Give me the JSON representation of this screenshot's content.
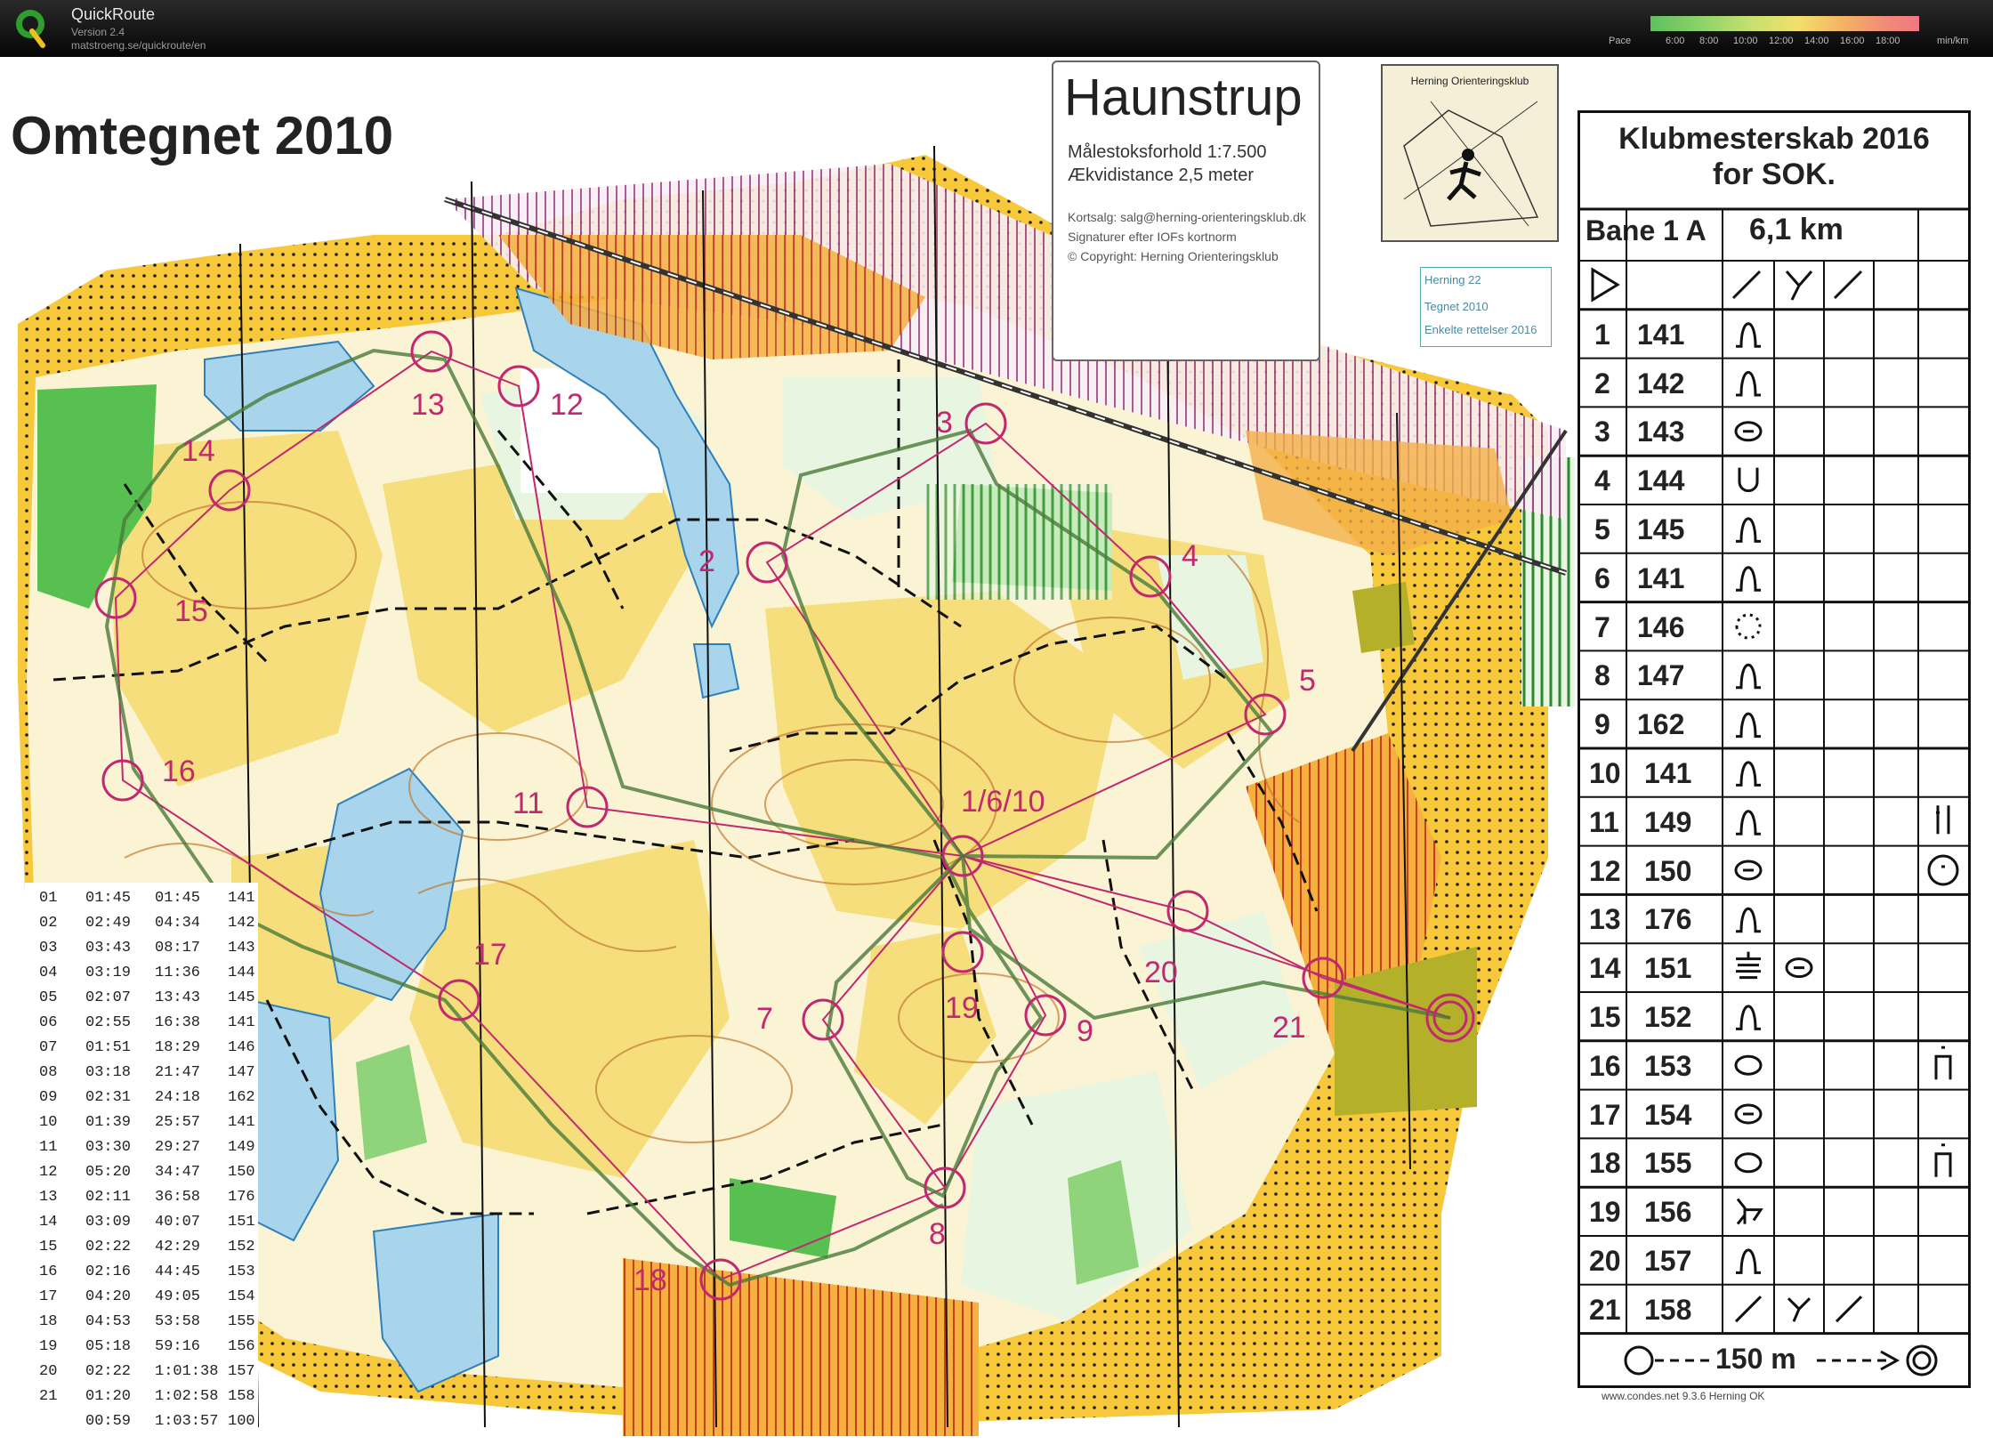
{
  "app": {
    "name": "QuickRoute",
    "version": "Version 2.4",
    "url": "matstroeng.se/quickroute/en",
    "pace_label": "Pace",
    "pace_ticks": [
      "6:00",
      "8:00",
      "10:00",
      "12:00",
      "14:00",
      "16:00",
      "18:00"
    ],
    "pace_unit": "min/km"
  },
  "map": {
    "title": "Omtegnet 2010",
    "name": "Haunstrup",
    "scale": "Målestoksforhold 1:7.500",
    "contour": "Ækvidistance 2,5 meter",
    "sales": "Kortsalg: salg@herning-orienteringsklub.dk",
    "symbols": "Signaturer efter IOFs kortnorm",
    "copyright": "© Copyright: Herning Orienteringsklub",
    "club_logo": "Herning Orienteringsklub",
    "edit_notes": [
      "Herning 22",
      "Tegnet 2010",
      "Enkelte rettelser 2016"
    ],
    "control_labels": [
      "1/6/10",
      "2",
      "3",
      "4",
      "5",
      "7",
      "8",
      "9",
      "11",
      "12",
      "13",
      "14",
      "15",
      "16",
      "17",
      "18",
      "19",
      "20",
      "21"
    ]
  },
  "description": {
    "title_line1": "Klubmesterskab 2016",
    "title_line2": "for SOK.",
    "course": "Bane 1 A",
    "length": "6,1 km",
    "controls": [
      {
        "n": "1",
        "code": "141",
        "symbol": "knoll"
      },
      {
        "n": "2",
        "code": "142",
        "symbol": "knoll"
      },
      {
        "n": "3",
        "code": "143",
        "symbol": "elongated-knoll"
      },
      {
        "n": "4",
        "code": "144",
        "symbol": "depression"
      },
      {
        "n": "5",
        "code": "145",
        "symbol": "knoll"
      },
      {
        "n": "6",
        "code": "141",
        "symbol": "knoll"
      },
      {
        "n": "7",
        "code": "146",
        "symbol": "pit"
      },
      {
        "n": "8",
        "code": "147",
        "symbol": "knoll"
      },
      {
        "n": "9",
        "code": "162",
        "symbol": "knoll"
      },
      {
        "n": "10",
        "code": "141",
        "symbol": "knoll"
      },
      {
        "n": "11",
        "code": "149",
        "symbol": "knoll",
        "detail": "top"
      },
      {
        "n": "12",
        "code": "150",
        "symbol": "elongated-knoll",
        "detail": "circle"
      },
      {
        "n": "13",
        "code": "176",
        "symbol": "knoll"
      },
      {
        "n": "14",
        "code": "151",
        "symbol": "terraces",
        "detail2": "elongated-knoll"
      },
      {
        "n": "15",
        "code": "152",
        "symbol": "knoll"
      },
      {
        "n": "16",
        "code": "153",
        "symbol": "oval",
        "detail": "foot"
      },
      {
        "n": "17",
        "code": "154",
        "symbol": "elongated-knoll"
      },
      {
        "n": "18",
        "code": "155",
        "symbol": "oval",
        "detail": "foot"
      },
      {
        "n": "19",
        "code": "156",
        "symbol": "re-entrant"
      },
      {
        "n": "20",
        "code": "157",
        "symbol": "knoll"
      },
      {
        "n": "21",
        "code": "158",
        "symbol": "path-junction"
      }
    ],
    "finish": "150 m",
    "credit": "www.condes.net 9.3.6 Herning OK"
  },
  "splits": [
    {
      "n": "01",
      "leg": "01:45",
      "cum": "01:45",
      "code": "141"
    },
    {
      "n": "02",
      "leg": "02:49",
      "cum": "04:34",
      "code": "142"
    },
    {
      "n": "03",
      "leg": "03:43",
      "cum": "08:17",
      "code": "143"
    },
    {
      "n": "04",
      "leg": "03:19",
      "cum": "11:36",
      "code": "144"
    },
    {
      "n": "05",
      "leg": "02:07",
      "cum": "13:43",
      "code": "145"
    },
    {
      "n": "06",
      "leg": "02:55",
      "cum": "16:38",
      "code": "141"
    },
    {
      "n": "07",
      "leg": "01:51",
      "cum": "18:29",
      "code": "146"
    },
    {
      "n": "08",
      "leg": "03:18",
      "cum": "21:47",
      "code": "147"
    },
    {
      "n": "09",
      "leg": "02:31",
      "cum": "24:18",
      "code": "162"
    },
    {
      "n": "10",
      "leg": "01:39",
      "cum": "25:57",
      "code": "141"
    },
    {
      "n": "11",
      "leg": "03:30",
      "cum": "29:27",
      "code": "149"
    },
    {
      "n": "12",
      "leg": "05:20",
      "cum": "34:47",
      "code": "150"
    },
    {
      "n": "13",
      "leg": "02:11",
      "cum": "36:58",
      "code": "176"
    },
    {
      "n": "14",
      "leg": "03:09",
      "cum": "40:07",
      "code": "151"
    },
    {
      "n": "15",
      "leg": "02:22",
      "cum": "42:29",
      "code": "152"
    },
    {
      "n": "16",
      "leg": "02:16",
      "cum": "44:45",
      "code": "153"
    },
    {
      "n": "17",
      "leg": "04:20",
      "cum": "49:05",
      "code": "154"
    },
    {
      "n": "18",
      "leg": "04:53",
      "cum": "53:58",
      "code": "155"
    },
    {
      "n": "19",
      "leg": "05:18",
      "cum": "59:16",
      "code": "156"
    },
    {
      "n": "20",
      "leg": "02:22",
      "cum": "1:01:38",
      "code": "157"
    },
    {
      "n": "21",
      "leg": "01:20",
      "cum": "1:02:58",
      "code": "158"
    },
    {
      "n": "",
      "leg": "00:59",
      "cum": "1:03:57",
      "code": "100"
    }
  ],
  "colors": {
    "header_bg": "#111111",
    "open_land": "#f7dd6e",
    "rough_open": "#fbeeb0",
    "forest": "#ffffff",
    "green": "#58c050",
    "water": "#a8d4ec",
    "course": "#c2286f",
    "route": "#4a7a3a",
    "contour": "#c07a30"
  }
}
